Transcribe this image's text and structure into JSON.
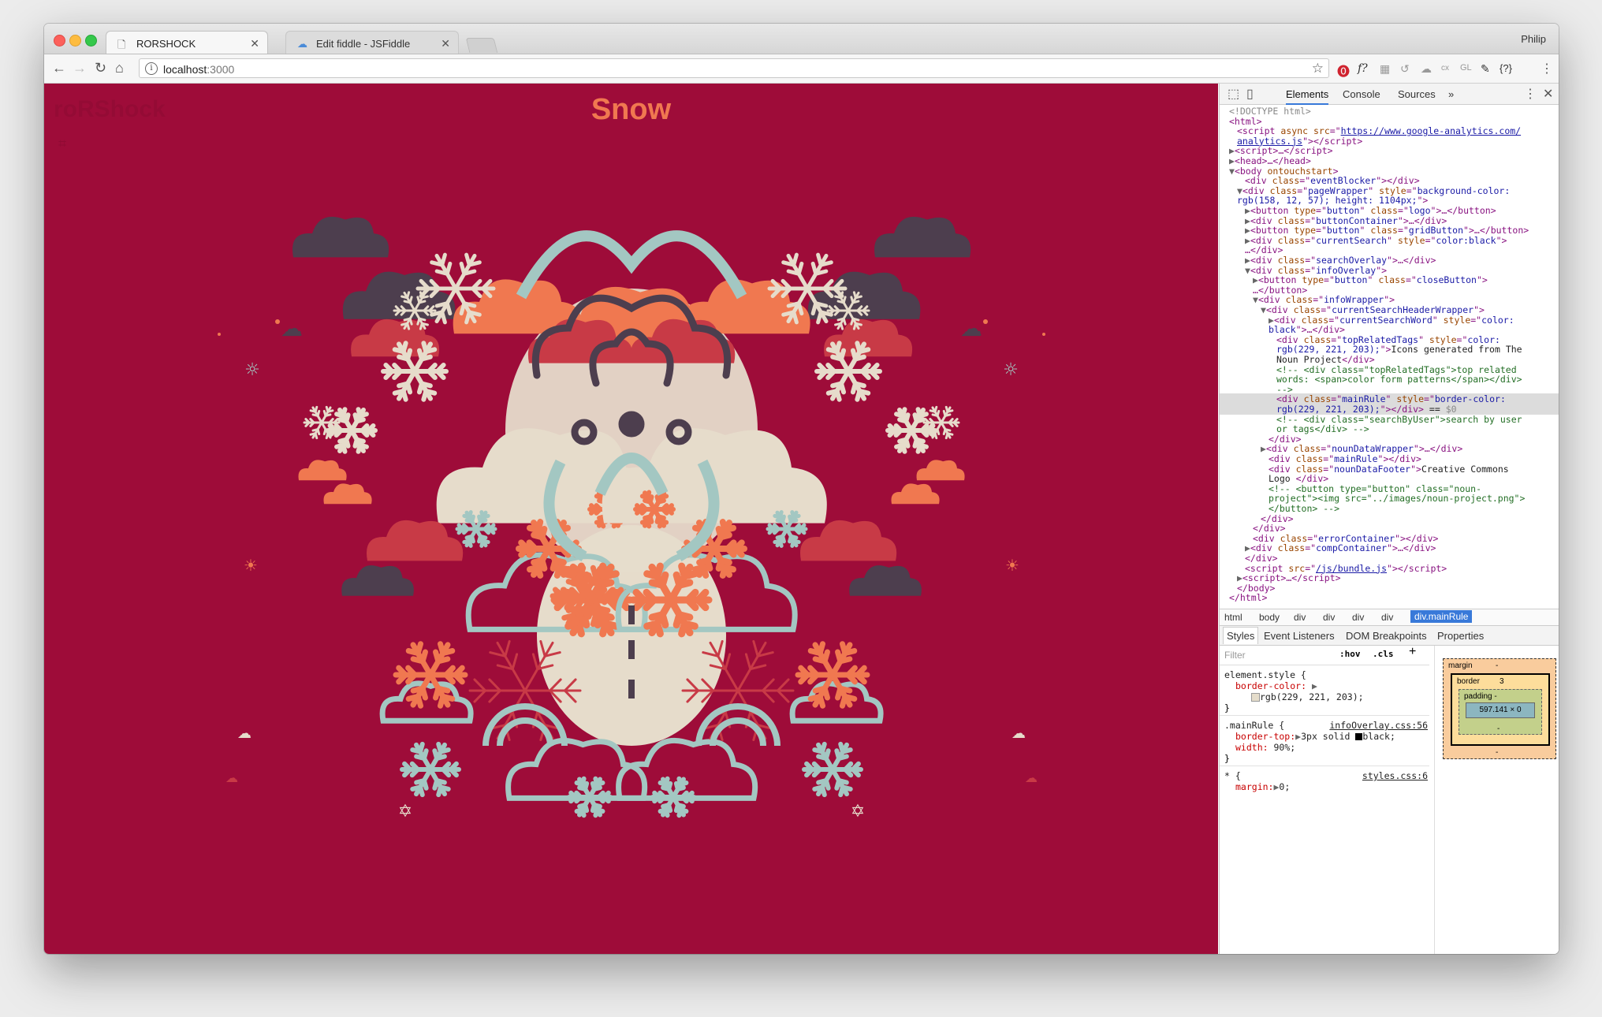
{
  "browser": {
    "tabs": [
      {
        "title": "RORSHOCK",
        "active": true
      },
      {
        "title": "Edit fiddle - JSFiddle",
        "active": false
      }
    ],
    "profile_name": "Philip",
    "address": {
      "host": "localhost",
      "port": ":3000"
    }
  },
  "page": {
    "logo_text": "roRShock",
    "current_search": "Snow",
    "colors": {
      "background": "#9e0c39",
      "cream": "#e6dccb",
      "teal": "#a3c7c2",
      "coral": "#f07850",
      "red": "#c83a46",
      "dark": "#4d3e4e"
    }
  },
  "devtools": {
    "tabs": [
      "Elements",
      "Console",
      "Sources"
    ],
    "more": "»",
    "dom_lines": [
      {
        "d": 0,
        "h": "<span class='dt'>&lt;!DOCTYPE html&gt;</span>"
      },
      {
        "d": 0,
        "h": "<span class='tag'>&lt;html&gt;</span>"
      },
      {
        "d": 1,
        "h": "<span class='tag'>&lt;script</span> <span class='an'>async</span> <span class='an'>src</span>=\"<span class='lk'>https://www.google-analytics.com/</span>"
      },
      {
        "d": 1,
        "h": "<span class='lk'>analytics.js</span>\"<span class='tag'>&gt;&lt;/script&gt;</span>"
      },
      {
        "d": 0,
        "h": "<span class='ar'>▶</span><span class='tag'>&lt;script&gt;</span>…<span class='tag'>&lt;/script&gt;</span>"
      },
      {
        "d": 0,
        "h": "<span class='ar'>▶</span><span class='tag'>&lt;head&gt;</span>…<span class='tag'>&lt;/head&gt;</span>"
      },
      {
        "d": 0,
        "h": "<span class='ar'>▼</span><span class='tag'>&lt;body</span> <span class='an'>ontouchstart</span><span class='tag'>&gt;</span>"
      },
      {
        "d": 2,
        "h": "<span class='tag'>&lt;div</span> <span class='an'>class</span>=\"<span class='av'>eventBlocker</span>\"<span class='tag'>&gt;&lt;/div&gt;</span>"
      },
      {
        "d": 1,
        "h": "<span class='ar'>▼</span><span class='tag'>&lt;div</span> <span class='an'>class</span>=\"<span class='av'>pageWrapper</span>\" <span class='an'>style</span>=\"<span class='av'>background-color:</span>"
      },
      {
        "d": 1,
        "h": "<span class='av'>rgb(158, 12, 57); height: 1104px;</span>\"<span class='tag'>&gt;</span>"
      },
      {
        "d": 2,
        "h": "<span class='ar'>▶</span><span class='tag'>&lt;button</span> <span class='an'>type</span>=\"<span class='av'>button</span>\" <span class='an'>class</span>=\"<span class='av'>logo</span>\"<span class='tag'>&gt;</span>…<span class='tag'>&lt;/button&gt;</span>"
      },
      {
        "d": 2,
        "h": "<span class='ar'>▶</span><span class='tag'>&lt;div</span> <span class='an'>class</span>=\"<span class='av'>buttonContainer</span>\"<span class='tag'>&gt;</span>…<span class='tag'>&lt;/div&gt;</span>"
      },
      {
        "d": 2,
        "h": "<span class='ar'>▶</span><span class='tag'>&lt;button</span> <span class='an'>type</span>=\"<span class='av'>button</span>\" <span class='an'>class</span>=\"<span class='av'>gridButton</span>\"<span class='tag'>&gt;</span>…<span class='tag'>&lt;/button&gt;</span>"
      },
      {
        "d": 2,
        "h": "<span class='ar'>▶</span><span class='tag'>&lt;div</span> <span class='an'>class</span>=\"<span class='av'>currentSearch</span>\" <span class='an'>style</span>=\"<span class='av'>color:black</span>\"<span class='tag'>&gt;</span>"
      },
      {
        "d": 2,
        "h": "…<span class='tag'>&lt;/div&gt;</span>"
      },
      {
        "d": 2,
        "h": "<span class='ar'>▶</span><span class='tag'>&lt;div</span> <span class='an'>class</span>=\"<span class='av'>searchOverlay</span>\"<span class='tag'>&gt;</span>…<span class='tag'>&lt;/div&gt;</span>"
      },
      {
        "d": 2,
        "h": "<span class='ar'>▼</span><span class='tag'>&lt;div</span> <span class='an'>class</span>=\"<span class='av'>infoOverlay</span>\"<span class='tag'>&gt;</span>"
      },
      {
        "d": 3,
        "h": "<span class='ar'>▶</span><span class='tag'>&lt;button</span> <span class='an'>type</span>=\"<span class='av'>button</span>\" <span class='an'>class</span>=\"<span class='av'>closeButton</span>\"<span class='tag'>&gt;</span>"
      },
      {
        "d": 3,
        "h": "…<span class='tag'>&lt;/button&gt;</span>"
      },
      {
        "d": 3,
        "h": "<span class='ar'>▼</span><span class='tag'>&lt;div</span> <span class='an'>class</span>=\"<span class='av'>infoWrapper</span>\"<span class='tag'>&gt;</span>"
      },
      {
        "d": 4,
        "h": "<span class='ar'>▼</span><span class='tag'>&lt;div</span> <span class='an'>class</span>=\"<span class='av'>currentSearchHeaderWrapper</span>\"<span class='tag'>&gt;</span>"
      },
      {
        "d": 5,
        "h": "<span class='ar'>▶</span><span class='tag'>&lt;div</span> <span class='an'>class</span>=\"<span class='av'>currentSearchWord</span>\" <span class='an'>style</span>=\"<span class='av'>color:</span>"
      },
      {
        "d": 5,
        "h": "<span class='av'>black</span>\"<span class='tag'>&gt;</span>…<span class='tag'>&lt;/div&gt;</span>"
      },
      {
        "d": 6,
        "h": "<span class='tag'>&lt;div</span> <span class='an'>class</span>=\"<span class='av'>topRelatedTags</span>\" <span class='an'>style</span>=\"<span class='av'>color:</span>"
      },
      {
        "d": 6,
        "h": "<span class='av'>rgb(229, 221, 203);</span>\"<span class='tag'>&gt;</span><span class='tx'>Icons generated from The</span>"
      },
      {
        "d": 6,
        "h": "<span class='tx'>Noun Project</span><span class='tag'>&lt;/div&gt;</span>"
      },
      {
        "d": 6,
        "h": "<span class='cm'>&lt;!-- &lt;div class=\"topRelatedTags\"&gt;top related</span>"
      },
      {
        "d": 6,
        "h": "<span class='cm'>words: &lt;span&gt;color form patterns&lt;/span&gt;&lt;/div&gt;</span>"
      },
      {
        "d": 6,
        "h": "<span class='cm'>--&gt;</span>"
      },
      {
        "d": 6,
        "h": "<span class='tag'>&lt;div</span> <span class='an'>class</span>=\"<span class='av'>mainRule</span>\" <span class='an'>style</span>=\"<span class='av'>border-color:</span>",
        "sel": true
      },
      {
        "d": 6,
        "h": "<span class='av'>rgb(229, 221, 203);</span>\"<span class='tag'>&gt;&lt;/div&gt;</span> <span class='tx'>== </span><span class='dt'>$0</span>",
        "sel": true
      },
      {
        "d": 6,
        "h": "<span class='cm'>&lt;!-- &lt;div class=\"searchByUser\"&gt;search by user</span>"
      },
      {
        "d": 6,
        "h": "<span class='cm'>or tags&lt;/div&gt; --&gt;</span>"
      },
      {
        "d": 5,
        "h": "<span class='tag'>&lt;/div&gt;</span>"
      },
      {
        "d": 4,
        "h": "<span class='ar'>▶</span><span class='tag'>&lt;div</span> <span class='an'>class</span>=\"<span class='av'>nounDataWrapper</span>\"<span class='tag'>&gt;</span>…<span class='tag'>&lt;/div&gt;</span>"
      },
      {
        "d": 5,
        "h": "<span class='tag'>&lt;div</span> <span class='an'>class</span>=\"<span class='av'>mainRule</span>\"<span class='tag'>&gt;&lt;/div&gt;</span>"
      },
      {
        "d": 5,
        "h": "<span class='tag'>&lt;div</span> <span class='an'>class</span>=\"<span class='av'>nounDataFooter</span>\"<span class='tag'>&gt;</span><span class='tx'>Creative Commons</span>"
      },
      {
        "d": 5,
        "h": "<span class='tx'>Logo </span><span class='tag'>&lt;/div&gt;</span>"
      },
      {
        "d": 5,
        "h": "<span class='cm'>&lt;!-- &lt;button type=\"button\" class=\"noun-</span>"
      },
      {
        "d": 5,
        "h": "<span class='cm'>project\"&gt;&lt;img src=\"../images/noun-project.png\"&gt;</span>"
      },
      {
        "d": 5,
        "h": "<span class='cm'>&lt;/button&gt; --&gt;</span>"
      },
      {
        "d": 4,
        "h": "<span class='tag'>&lt;/div&gt;</span>"
      },
      {
        "d": 3,
        "h": "<span class='tag'>&lt;/div&gt;</span>"
      },
      {
        "d": 3,
        "h": "<span class='tag'>&lt;div</span> <span class='an'>class</span>=\"<span class='av'>errorContainer</span>\"<span class='tag'>&gt;&lt;/div&gt;</span>"
      },
      {
        "d": 2,
        "h": "<span class='ar'>▶</span><span class='tag'>&lt;div</span> <span class='an'>class</span>=\"<span class='av'>compContainer</span>\"<span class='tag'>&gt;</span>…<span class='tag'>&lt;/div&gt;</span>"
      },
      {
        "d": 2,
        "h": "<span class='tag'>&lt;/div&gt;</span>"
      },
      {
        "d": 2,
        "h": "<span class='tag'>&lt;script</span> <span class='an'>src</span>=\"<span class='lk'>/js/bundle.js</span>\"<span class='tag'>&gt;&lt;/script&gt;</span>"
      },
      {
        "d": 1,
        "h": "<span class='ar'>▶</span><span class='tag'>&lt;script&gt;</span>…<span class='tag'>&lt;/script&gt;</span>"
      },
      {
        "d": 1,
        "h": "<span class='tag'>&lt;/body&gt;</span>"
      },
      {
        "d": 0,
        "h": "<span class='tag'>&lt;/html&gt;</span>"
      }
    ],
    "breadcrumbs": [
      "html",
      "body",
      "div",
      "div",
      "div",
      "div",
      "div.mainRule"
    ],
    "subtabs": [
      "Styles",
      "Event Listeners",
      "DOM Breakpoints",
      "Properties"
    ],
    "filter_placeholder": "Filter",
    "hov": ":hov",
    "cls": ".cls",
    "plus": "+",
    "styles": {
      "element_style_selector": "element.style {",
      "border_color_prop": "border-color:",
      "border_color_val": "rgb(229, 221, 203);",
      "close": "}",
      "mainrule_selector": ".mainRule {",
      "mainrule_source": "infoOverlay.css:56",
      "border_top_prop": "border-top:",
      "border_top_val": "3px solid",
      "border_top_color": "black;",
      "width_prop": "width:",
      "width_val": "90%;",
      "star_selector": "* {",
      "star_source": "styles.css:6",
      "margin_prop": "margin:",
      "margin_val": "0;"
    },
    "box_model": {
      "margin_label": "margin",
      "margin_val": "-",
      "border_label": "border",
      "border_val": "3",
      "padding_label": "padding -",
      "content": "597.141 × 0",
      "dash": "-"
    }
  }
}
